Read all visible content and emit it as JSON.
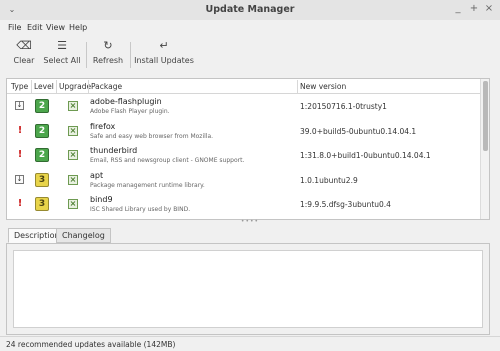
{
  "window": {
    "title": "Update Manager"
  },
  "titlebar": {
    "left_icon": "chevron-down-icon",
    "minimize": "_",
    "maximize": "+",
    "close": "×"
  },
  "menu": {
    "file": "File",
    "edit": "Edit",
    "view": "View",
    "help": "Help"
  },
  "toolbar": {
    "clear": {
      "label": "Clear",
      "icon": "⌫"
    },
    "select_all": {
      "label": "Select All",
      "icon": "☰"
    },
    "refresh": {
      "label": "Refresh",
      "icon": "↻"
    },
    "install": {
      "label": "Install Updates",
      "icon": "↵"
    }
  },
  "table": {
    "headers": {
      "type": "Type",
      "level": "Level",
      "upgrade": "Upgrade",
      "package": "Package",
      "version": "New version"
    },
    "rows": [
      {
        "type": "package",
        "type_icon": "↓",
        "level": "2",
        "level_color": "#4ca64c",
        "upgrade_icon": "×",
        "name": "adobe-flashplugin",
        "desc": "Adobe Flash Player plugin.",
        "version": "1:20150716.1-0trusty1"
      },
      {
        "type": "security",
        "type_icon": "!",
        "level": "2",
        "level_color": "#4ca64c",
        "upgrade_icon": "×",
        "name": "firefox",
        "desc": "Safe and easy web browser from Mozilla.",
        "version": "39.0+build5-0ubuntu0.14.04.1"
      },
      {
        "type": "security",
        "type_icon": "!",
        "level": "2",
        "level_color": "#4ca64c",
        "upgrade_icon": "×",
        "name": "thunderbird",
        "desc": "Email, RSS and newsgroup client - GNOME support.",
        "version": "1:31.8.0+build1-0ubuntu0.14.04.1"
      },
      {
        "type": "package",
        "type_icon": "↓",
        "level": "3",
        "level_color": "#e8d44a",
        "upgrade_icon": "×",
        "name": "apt",
        "desc": "Package management runtime library.",
        "version": "1.0.1ubuntu2.9"
      },
      {
        "type": "security",
        "type_icon": "!",
        "level": "3",
        "level_color": "#e8d44a",
        "upgrade_icon": "×",
        "name": "bind9",
        "desc": "ISC Shared Library used by BIND.",
        "version": "1:9.9.5.dfsg-3ubuntu0.4"
      }
    ]
  },
  "tabs": {
    "description": "Description",
    "changelog": "Changelog"
  },
  "status": {
    "text": "24 recommended updates available (142MB)"
  }
}
